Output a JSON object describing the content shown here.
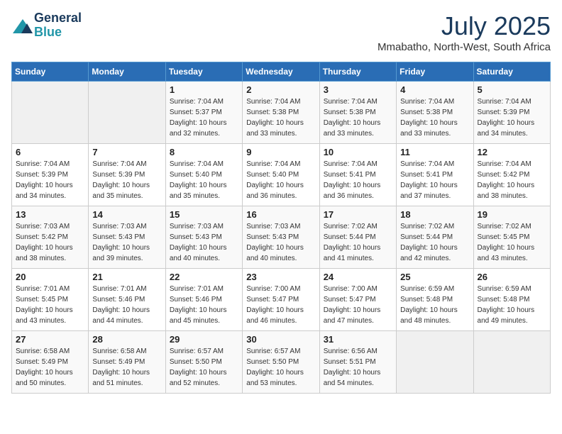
{
  "logo": {
    "line1": "General",
    "line2": "Blue"
  },
  "title": "July 2025",
  "subtitle": "Mmabatho, North-West, South Africa",
  "headers": [
    "Sunday",
    "Monday",
    "Tuesday",
    "Wednesday",
    "Thursday",
    "Friday",
    "Saturday"
  ],
  "rows": [
    [
      {
        "day": "",
        "info": ""
      },
      {
        "day": "",
        "info": ""
      },
      {
        "day": "1",
        "info": "Sunrise: 7:04 AM\nSunset: 5:37 PM\nDaylight: 10 hours\nand 32 minutes."
      },
      {
        "day": "2",
        "info": "Sunrise: 7:04 AM\nSunset: 5:38 PM\nDaylight: 10 hours\nand 33 minutes."
      },
      {
        "day": "3",
        "info": "Sunrise: 7:04 AM\nSunset: 5:38 PM\nDaylight: 10 hours\nand 33 minutes."
      },
      {
        "day": "4",
        "info": "Sunrise: 7:04 AM\nSunset: 5:38 PM\nDaylight: 10 hours\nand 33 minutes."
      },
      {
        "day": "5",
        "info": "Sunrise: 7:04 AM\nSunset: 5:39 PM\nDaylight: 10 hours\nand 34 minutes."
      }
    ],
    [
      {
        "day": "6",
        "info": "Sunrise: 7:04 AM\nSunset: 5:39 PM\nDaylight: 10 hours\nand 34 minutes."
      },
      {
        "day": "7",
        "info": "Sunrise: 7:04 AM\nSunset: 5:39 PM\nDaylight: 10 hours\nand 35 minutes."
      },
      {
        "day": "8",
        "info": "Sunrise: 7:04 AM\nSunset: 5:40 PM\nDaylight: 10 hours\nand 35 minutes."
      },
      {
        "day": "9",
        "info": "Sunrise: 7:04 AM\nSunset: 5:40 PM\nDaylight: 10 hours\nand 36 minutes."
      },
      {
        "day": "10",
        "info": "Sunrise: 7:04 AM\nSunset: 5:41 PM\nDaylight: 10 hours\nand 36 minutes."
      },
      {
        "day": "11",
        "info": "Sunrise: 7:04 AM\nSunset: 5:41 PM\nDaylight: 10 hours\nand 37 minutes."
      },
      {
        "day": "12",
        "info": "Sunrise: 7:04 AM\nSunset: 5:42 PM\nDaylight: 10 hours\nand 38 minutes."
      }
    ],
    [
      {
        "day": "13",
        "info": "Sunrise: 7:03 AM\nSunset: 5:42 PM\nDaylight: 10 hours\nand 38 minutes."
      },
      {
        "day": "14",
        "info": "Sunrise: 7:03 AM\nSunset: 5:43 PM\nDaylight: 10 hours\nand 39 minutes."
      },
      {
        "day": "15",
        "info": "Sunrise: 7:03 AM\nSunset: 5:43 PM\nDaylight: 10 hours\nand 40 minutes."
      },
      {
        "day": "16",
        "info": "Sunrise: 7:03 AM\nSunset: 5:43 PM\nDaylight: 10 hours\nand 40 minutes."
      },
      {
        "day": "17",
        "info": "Sunrise: 7:02 AM\nSunset: 5:44 PM\nDaylight: 10 hours\nand 41 minutes."
      },
      {
        "day": "18",
        "info": "Sunrise: 7:02 AM\nSunset: 5:44 PM\nDaylight: 10 hours\nand 42 minutes."
      },
      {
        "day": "19",
        "info": "Sunrise: 7:02 AM\nSunset: 5:45 PM\nDaylight: 10 hours\nand 43 minutes."
      }
    ],
    [
      {
        "day": "20",
        "info": "Sunrise: 7:01 AM\nSunset: 5:45 PM\nDaylight: 10 hours\nand 43 minutes."
      },
      {
        "day": "21",
        "info": "Sunrise: 7:01 AM\nSunset: 5:46 PM\nDaylight: 10 hours\nand 44 minutes."
      },
      {
        "day": "22",
        "info": "Sunrise: 7:01 AM\nSunset: 5:46 PM\nDaylight: 10 hours\nand 45 minutes."
      },
      {
        "day": "23",
        "info": "Sunrise: 7:00 AM\nSunset: 5:47 PM\nDaylight: 10 hours\nand 46 minutes."
      },
      {
        "day": "24",
        "info": "Sunrise: 7:00 AM\nSunset: 5:47 PM\nDaylight: 10 hours\nand 47 minutes."
      },
      {
        "day": "25",
        "info": "Sunrise: 6:59 AM\nSunset: 5:48 PM\nDaylight: 10 hours\nand 48 minutes."
      },
      {
        "day": "26",
        "info": "Sunrise: 6:59 AM\nSunset: 5:48 PM\nDaylight: 10 hours\nand 49 minutes."
      }
    ],
    [
      {
        "day": "27",
        "info": "Sunrise: 6:58 AM\nSunset: 5:49 PM\nDaylight: 10 hours\nand 50 minutes."
      },
      {
        "day": "28",
        "info": "Sunrise: 6:58 AM\nSunset: 5:49 PM\nDaylight: 10 hours\nand 51 minutes."
      },
      {
        "day": "29",
        "info": "Sunrise: 6:57 AM\nSunset: 5:50 PM\nDaylight: 10 hours\nand 52 minutes."
      },
      {
        "day": "30",
        "info": "Sunrise: 6:57 AM\nSunset: 5:50 PM\nDaylight: 10 hours\nand 53 minutes."
      },
      {
        "day": "31",
        "info": "Sunrise: 6:56 AM\nSunset: 5:51 PM\nDaylight: 10 hours\nand 54 minutes."
      },
      {
        "day": "",
        "info": ""
      },
      {
        "day": "",
        "info": ""
      }
    ]
  ]
}
